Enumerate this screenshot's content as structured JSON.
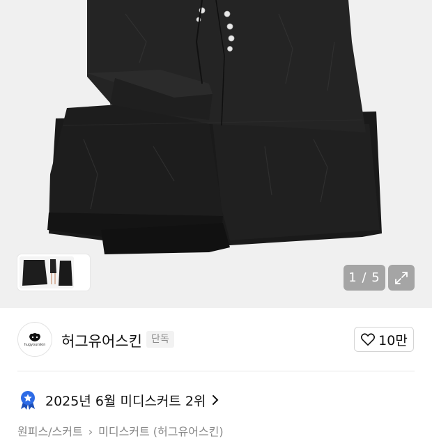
{
  "gallery": {
    "counter": "1 / 5",
    "expand_icon": "expand-icon",
    "thumbnail_next_icon": "chevron-right-icon",
    "colors": {
      "background": "#f0f0f0",
      "skirt": "#1c1c1c",
      "overlay": "#8c8c8c"
    }
  },
  "brand": {
    "logo_text": "hugyourskin",
    "name": "허그유어스킨",
    "tag": "단독",
    "like_icon": "heart-outline-icon",
    "like_count": "10만"
  },
  "ranking": {
    "badge_icon": "star-ribbon-icon",
    "badge_color": "#2d6be6",
    "text": "2025년 6월 미디스커트 2위",
    "chevron_icon": "chevron-right-icon"
  },
  "breadcrumb": {
    "items": [
      "원피스/스커트",
      "미디스커트 (허그유어스킨)"
    ],
    "separator": "›"
  }
}
